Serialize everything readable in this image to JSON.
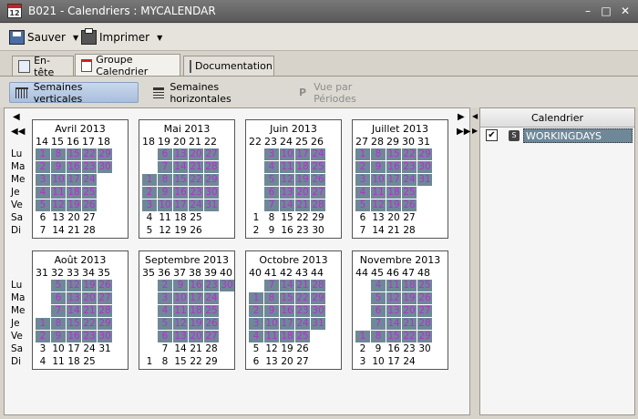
{
  "window": {
    "title": "B021 - Calendriers : MYCALENDAR",
    "app_icon_text": "12"
  },
  "toolbar": {
    "save_label": "Sauver",
    "print_label": "Imprimer"
  },
  "tabs": [
    {
      "label": "En-tête",
      "active": false
    },
    {
      "label": "Groupe Calendrier",
      "active": true
    },
    {
      "label": "Documentation",
      "active": false
    }
  ],
  "views": [
    {
      "label": "Semaines verticales",
      "active": true,
      "enabled": true
    },
    {
      "label": "Semaines horizontales",
      "active": false,
      "enabled": true
    },
    {
      "label": "Vue par Périodes",
      "active": false,
      "enabled": false
    }
  ],
  "day_labels": [
    "Lu",
    "Ma",
    "Me",
    "Je",
    "Ve",
    "Sa",
    "Di"
  ],
  "months": [
    {
      "title": "Avril  2013",
      "weeks": [
        "14",
        "15",
        "16",
        "17",
        "18"
      ],
      "days": [
        [
          "1",
          "8",
          "15",
          "22",
          "29"
        ],
        [
          "2",
          "9",
          "16",
          "23",
          "30"
        ],
        [
          "3",
          "10",
          "17",
          "24",
          ""
        ],
        [
          "4",
          "11",
          "18",
          "25",
          ""
        ],
        [
          "5",
          "12",
          "19",
          "26",
          ""
        ],
        [
          "6",
          "13",
          "20",
          "27",
          ""
        ],
        [
          "7",
          "14",
          "21",
          "28",
          ""
        ]
      ],
      "working": [
        [
          1,
          1,
          1,
          1,
          1
        ],
        [
          1,
          1,
          1,
          1,
          1
        ],
        [
          1,
          1,
          1,
          1,
          0
        ],
        [
          1,
          1,
          1,
          1,
          0
        ],
        [
          1,
          1,
          1,
          1,
          0
        ],
        [
          0,
          0,
          0,
          0,
          0
        ],
        [
          0,
          0,
          0,
          0,
          0
        ]
      ]
    },
    {
      "title": "Mai  2013",
      "weeks": [
        "18",
        "19",
        "20",
        "21",
        "22"
      ],
      "days": [
        [
          "",
          "6",
          "13",
          "20",
          "27"
        ],
        [
          "",
          "7",
          "14",
          "21",
          "28"
        ],
        [
          "1",
          "8",
          "15",
          "22",
          "29"
        ],
        [
          "2",
          "9",
          "16",
          "23",
          "30"
        ],
        [
          "3",
          "10",
          "17",
          "24",
          "31"
        ],
        [
          "4",
          "11",
          "18",
          "25",
          ""
        ],
        [
          "5",
          "12",
          "19",
          "26",
          ""
        ]
      ],
      "working": [
        [
          0,
          1,
          1,
          1,
          1
        ],
        [
          0,
          1,
          1,
          1,
          1
        ],
        [
          1,
          1,
          1,
          1,
          1
        ],
        [
          1,
          1,
          1,
          1,
          1
        ],
        [
          1,
          1,
          1,
          1,
          1
        ],
        [
          0,
          0,
          0,
          0,
          0
        ],
        [
          0,
          0,
          0,
          0,
          0
        ]
      ]
    },
    {
      "title": "Juin  2013",
      "weeks": [
        "22",
        "23",
        "24",
        "25",
        "26"
      ],
      "days": [
        [
          "",
          "3",
          "10",
          "17",
          "24"
        ],
        [
          "",
          "4",
          "11",
          "18",
          "25"
        ],
        [
          "",
          "5",
          "12",
          "19",
          "26"
        ],
        [
          "",
          "6",
          "13",
          "20",
          "27"
        ],
        [
          "",
          "7",
          "14",
          "21",
          "28"
        ],
        [
          "1",
          "8",
          "15",
          "22",
          "29"
        ],
        [
          "2",
          "9",
          "16",
          "23",
          "30"
        ]
      ],
      "working": [
        [
          0,
          1,
          1,
          1,
          1
        ],
        [
          0,
          1,
          1,
          1,
          1
        ],
        [
          0,
          1,
          1,
          1,
          1
        ],
        [
          0,
          1,
          1,
          1,
          1
        ],
        [
          0,
          1,
          1,
          1,
          1
        ],
        [
          0,
          0,
          0,
          0,
          0
        ],
        [
          0,
          0,
          0,
          0,
          0
        ]
      ]
    },
    {
      "title": "Juillet  2013",
      "weeks": [
        "27",
        "28",
        "29",
        "30",
        "31"
      ],
      "days": [
        [
          "1",
          "8",
          "15",
          "22",
          "29"
        ],
        [
          "2",
          "9",
          "16",
          "23",
          "30"
        ],
        [
          "3",
          "10",
          "17",
          "24",
          "31"
        ],
        [
          "4",
          "11",
          "18",
          "25",
          ""
        ],
        [
          "5",
          "12",
          "19",
          "26",
          ""
        ],
        [
          "6",
          "13",
          "20",
          "27",
          ""
        ],
        [
          "7",
          "14",
          "21",
          "28",
          ""
        ]
      ],
      "working": [
        [
          1,
          1,
          1,
          1,
          1
        ],
        [
          1,
          1,
          1,
          1,
          1
        ],
        [
          1,
          1,
          1,
          1,
          1
        ],
        [
          1,
          1,
          1,
          1,
          0
        ],
        [
          1,
          1,
          1,
          1,
          0
        ],
        [
          0,
          0,
          0,
          0,
          0
        ],
        [
          0,
          0,
          0,
          0,
          0
        ]
      ]
    },
    {
      "title": "Août  2013",
      "weeks": [
        "31",
        "32",
        "33",
        "34",
        "35"
      ],
      "days": [
        [
          "",
          "5",
          "12",
          "19",
          "26"
        ],
        [
          "",
          "6",
          "13",
          "20",
          "27"
        ],
        [
          "",
          "7",
          "14",
          "21",
          "28"
        ],
        [
          "1",
          "8",
          "15",
          "22",
          "29"
        ],
        [
          "2",
          "9",
          "16",
          "23",
          "30"
        ],
        [
          "3",
          "10",
          "17",
          "24",
          "31"
        ],
        [
          "4",
          "11",
          "18",
          "25",
          ""
        ]
      ],
      "working": [
        [
          0,
          1,
          1,
          1,
          1
        ],
        [
          0,
          1,
          1,
          1,
          1
        ],
        [
          0,
          1,
          1,
          1,
          1
        ],
        [
          1,
          1,
          1,
          1,
          1
        ],
        [
          1,
          1,
          1,
          1,
          1
        ],
        [
          0,
          0,
          0,
          0,
          0
        ],
        [
          0,
          0,
          0,
          0,
          0
        ]
      ]
    },
    {
      "title": "Septembre  2013",
      "weeks": [
        "35",
        "36",
        "37",
        "38",
        "39",
        "40"
      ],
      "days": [
        [
          "",
          "2",
          "9",
          "16",
          "23",
          "30"
        ],
        [
          "",
          "3",
          "10",
          "17",
          "24",
          ""
        ],
        [
          "",
          "4",
          "11",
          "18",
          "25",
          ""
        ],
        [
          "",
          "5",
          "12",
          "19",
          "26",
          ""
        ],
        [
          "",
          "6",
          "13",
          "20",
          "27",
          ""
        ],
        [
          "",
          "7",
          "14",
          "21",
          "28",
          ""
        ],
        [
          "1",
          "8",
          "15",
          "22",
          "29",
          ""
        ]
      ],
      "working": [
        [
          0,
          1,
          1,
          1,
          1,
          1
        ],
        [
          0,
          1,
          1,
          1,
          1,
          0
        ],
        [
          0,
          1,
          1,
          1,
          1,
          0
        ],
        [
          0,
          1,
          1,
          1,
          1,
          0
        ],
        [
          0,
          1,
          1,
          1,
          1,
          0
        ],
        [
          0,
          0,
          0,
          0,
          0,
          0
        ],
        [
          0,
          0,
          0,
          0,
          0,
          0
        ]
      ]
    },
    {
      "title": "Octobre  2013",
      "weeks": [
        "40",
        "41",
        "42",
        "43",
        "44"
      ],
      "days": [
        [
          "",
          "7",
          "14",
          "21",
          "28"
        ],
        [
          "1",
          "8",
          "15",
          "22",
          "29"
        ],
        [
          "2",
          "9",
          "16",
          "23",
          "30"
        ],
        [
          "3",
          "10",
          "17",
          "24",
          "31"
        ],
        [
          "4",
          "11",
          "18",
          "25",
          ""
        ],
        [
          "5",
          "12",
          "19",
          "26",
          ""
        ],
        [
          "6",
          "13",
          "20",
          "27",
          ""
        ]
      ],
      "working": [
        [
          0,
          1,
          1,
          1,
          1
        ],
        [
          1,
          1,
          1,
          1,
          1
        ],
        [
          1,
          1,
          1,
          1,
          1
        ],
        [
          1,
          1,
          1,
          1,
          1
        ],
        [
          1,
          1,
          1,
          1,
          0
        ],
        [
          0,
          0,
          0,
          0,
          0
        ],
        [
          0,
          0,
          0,
          0,
          0
        ]
      ]
    },
    {
      "title": "Novembre  2013",
      "weeks": [
        "44",
        "45",
        "46",
        "47",
        "48"
      ],
      "days": [
        [
          "",
          "4",
          "11",
          "18",
          "25"
        ],
        [
          "",
          "5",
          "12",
          "19",
          "26"
        ],
        [
          "",
          "6",
          "13",
          "20",
          "27"
        ],
        [
          "",
          "7",
          "14",
          "21",
          "28"
        ],
        [
          "1",
          "8",
          "15",
          "22",
          "29"
        ],
        [
          "2",
          "9",
          "16",
          "23",
          "30"
        ],
        [
          "3",
          "10",
          "17",
          "24",
          ""
        ]
      ],
      "working": [
        [
          0,
          1,
          1,
          1,
          1
        ],
        [
          0,
          1,
          1,
          1,
          1
        ],
        [
          0,
          1,
          1,
          1,
          1
        ],
        [
          0,
          1,
          1,
          1,
          1
        ],
        [
          1,
          1,
          1,
          1,
          1
        ],
        [
          0,
          0,
          0,
          0,
          0
        ],
        [
          0,
          0,
          0,
          0,
          0
        ]
      ]
    }
  ],
  "right_panel": {
    "header": "Calendrier",
    "item_label": "WORKINGDAYS",
    "item_checked": true,
    "item_icon_text": "S"
  },
  "colors": {
    "working_bg": "#6f8898",
    "working_text": "#b62fd0"
  }
}
